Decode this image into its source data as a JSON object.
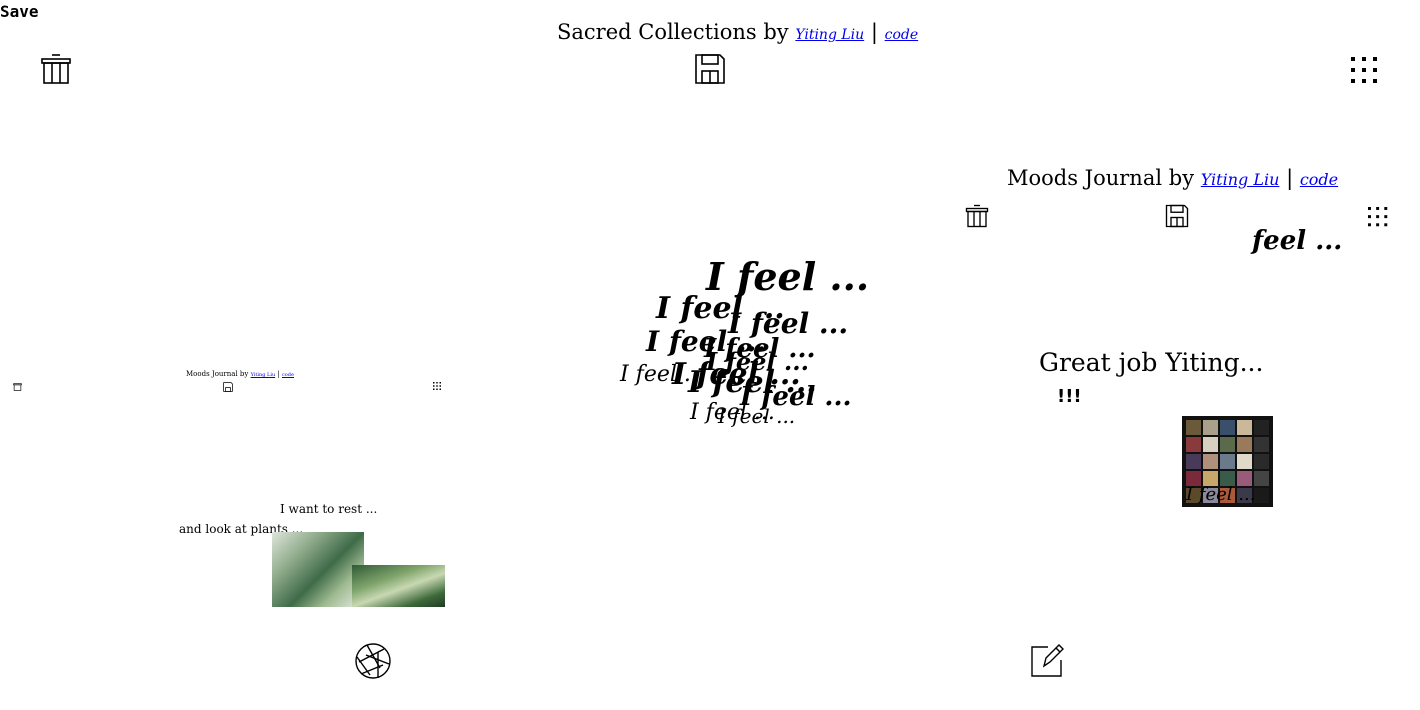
{
  "save_label": "Save",
  "main": {
    "title": "Sacred Collections by",
    "author": "Yiting Liu",
    "separator": "|",
    "code": "code"
  },
  "panel_right": {
    "title": "Moods Journal by",
    "author": "Yiting Liu",
    "separator": "|",
    "code": "code",
    "feel_text": "feel ...",
    "great_job": "Great job Yiting...",
    "exclaim": "!!!",
    "photo_caption": "I feel ..."
  },
  "panel_left": {
    "title": "Moods Journal by",
    "author": "Yiting Liu",
    "separator": "|",
    "code": "code",
    "rest_text": "I want to rest ...",
    "plants_text": "and look at plants ..."
  },
  "feel_cloud": [
    "I feel ...",
    "I feel ...",
    "I feel ...",
    "I feel ...",
    "I feel ...",
    "I feel ...",
    "I feel ...",
    "I feel ...",
    "I feel ...",
    "I feel ...",
    "I feel ...",
    "I feel ..."
  ],
  "icons": {
    "trash": "trash-icon",
    "save": "floppy-disk-icon",
    "grid": "grid-icon",
    "camera": "camera-aperture-icon",
    "edit": "pencil-edit-icon"
  },
  "colors": {
    "link": "#0000ee",
    "text": "#000000",
    "background": "#ffffff"
  }
}
